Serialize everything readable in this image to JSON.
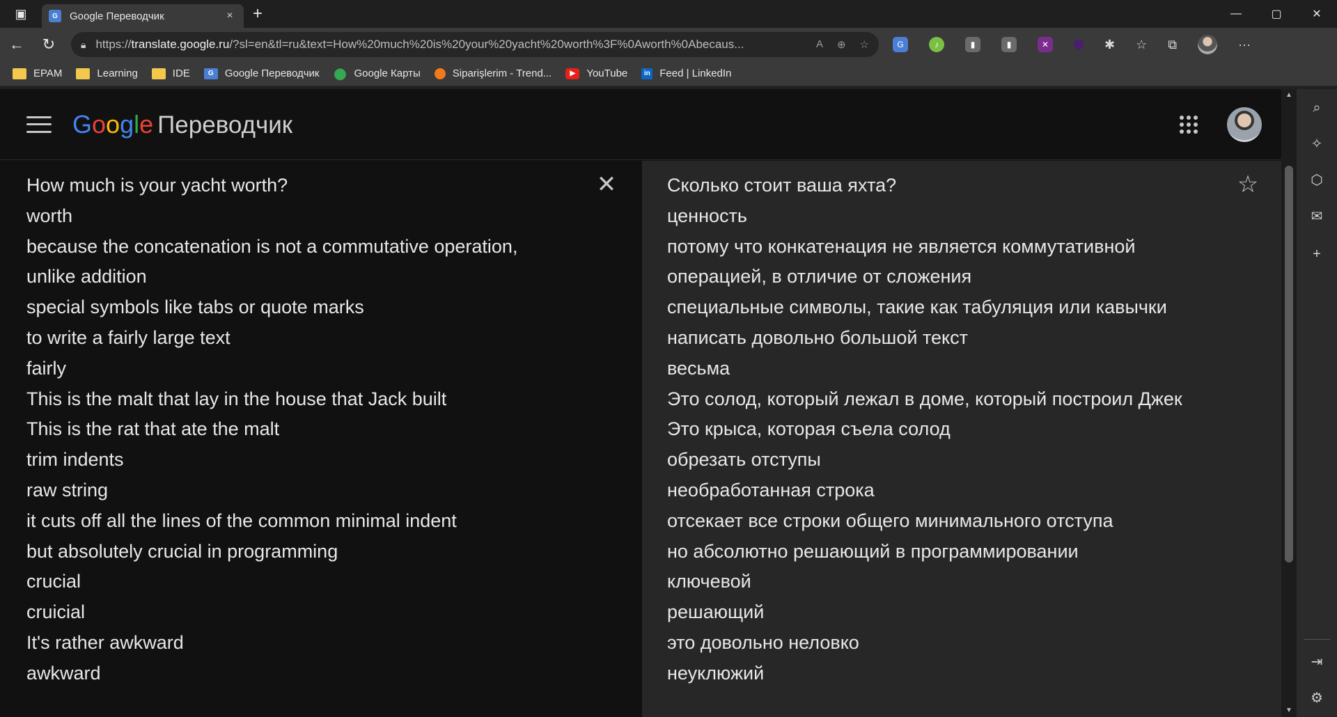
{
  "browser": {
    "tab": {
      "favicon": "G",
      "title": "Google Переводчик",
      "close_icon": "×"
    },
    "new_tab_icon": "+",
    "window_controls": {
      "minimize": "—",
      "maximize": "▢",
      "close": "✕"
    },
    "nav": {
      "back": "←",
      "refresh": "↻"
    },
    "address": {
      "scheme": "https://",
      "host": "translate.google.ru",
      "path": "/?sl=en&tl=ru&text=How%20much%20is%20your%20yacht%20worth%3F%0Aworth%0Abecaus..."
    },
    "toolbar_icons": [
      "read-aloud-icon",
      "zoom-icon",
      "favorite-add-icon",
      "translate-ext-icon",
      "green-ext-icon",
      "chart-ext-icon",
      "chart-ext-2-icon",
      "purple-ext-icon",
      "dark-purple-ext-icon",
      "extensions-icon",
      "favorites-icon",
      "collections-icon",
      "profile-avatar",
      "more-icon"
    ],
    "bookmarks": [
      {
        "label": "EPAM",
        "icon": "folder-icon"
      },
      {
        "label": "Learning",
        "icon": "folder-icon"
      },
      {
        "label": "IDE",
        "icon": "folder-icon"
      },
      {
        "label": "Google Переводчик",
        "icon": "google-translate-icon"
      },
      {
        "label": "Google Карты",
        "icon": "google-maps-icon"
      },
      {
        "label": "Siparişlerim - Trend...",
        "icon": "trendyol-icon"
      },
      {
        "label": "YouTube",
        "icon": "youtube-icon"
      },
      {
        "label": "Feed | LinkedIn",
        "icon": "linkedin-icon"
      }
    ]
  },
  "header": {
    "logo_letters": [
      "G",
      "o",
      "o",
      "g",
      "l",
      "e"
    ],
    "product_name": "Переводчик"
  },
  "source": {
    "lines": [
      "How much is your yacht worth?",
      "worth",
      "because the concatenation is not a commutative operation,",
      "unlike addition",
      "special symbols like tabs or quote marks",
      "to write a fairly large text",
      "fairly",
      "This is the malt that lay in the house that Jack built",
      "This is the rat that ate the malt",
      "trim indents",
      "raw string",
      "it cuts off all the lines of the common minimal indent",
      "but absolutely crucial in programming",
      "crucial",
      "cruicial",
      "It's rather awkward",
      "awkward"
    ],
    "clear_icon": "✕"
  },
  "target": {
    "lines": [
      "Сколько стоит ваша яхта?",
      "ценность",
      "потому что конкатенация не является коммутативной",
      "операцией, в отличие от сложения",
      "специальные символы, такие как табуляция или кавычки",
      "написать довольно большой текст",
      "весьма",
      "Это солод, который лежал в доме, который построил Джек",
      "Это крыса, которая съела солод",
      "обрезать отступы",
      "необработанная строка",
      "отсекает все строки общего минимального отступа",
      "но абсолютно решающий в программировании",
      "ключевой",
      "решающий",
      "это довольно неловко",
      "неуклюжий"
    ],
    "star_icon": "☆"
  },
  "colors": {
    "google_blue": "#4285f4",
    "google_red": "#ea4335",
    "google_yellow": "#fbbc05",
    "google_green": "#34a853",
    "page_bg": "#111111",
    "translation_bg": "#272727"
  }
}
